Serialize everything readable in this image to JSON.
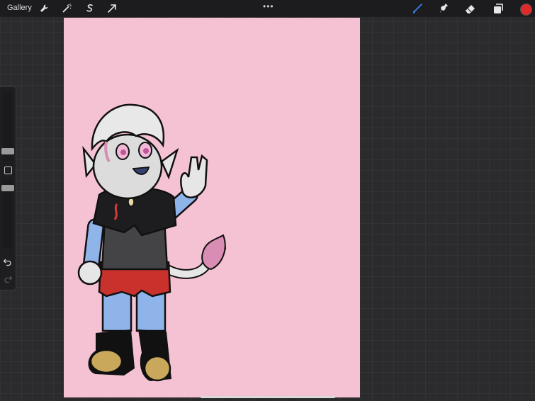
{
  "app": {
    "gallery_label": "Gallery",
    "more_menu": "•••",
    "actions_tools": [
      "wrench-icon",
      "magic-wand-icon",
      "selection-s-icon",
      "transform-arrow-icon"
    ],
    "paint_tools": [
      "brush-icon",
      "smudge-icon",
      "eraser-icon",
      "layers-icon"
    ],
    "current_color": "#e02a2a"
  },
  "canvas": {
    "background_color": "#f5c2d4",
    "subject": "artwork"
  },
  "sidebar": {
    "brush_size_level": 0.28,
    "opacity_level": 0.5
  }
}
